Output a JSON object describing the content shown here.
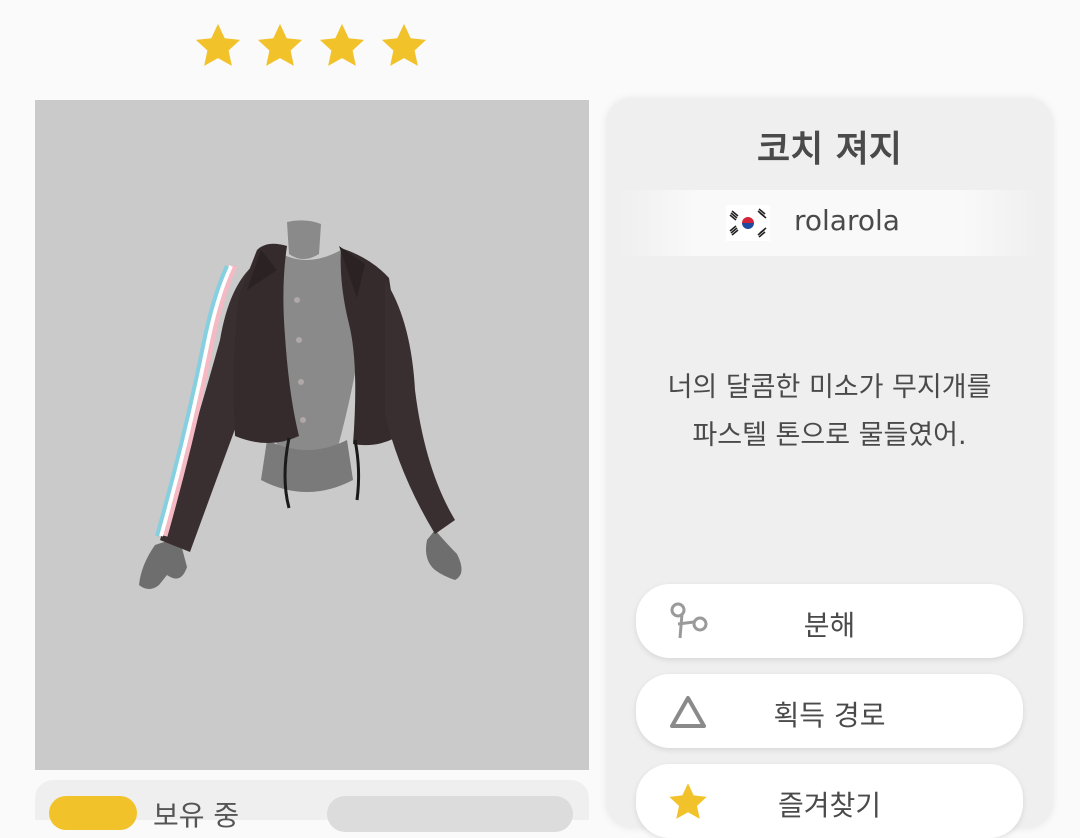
{
  "rating": {
    "stars": 4,
    "star_color": "#f2c22a"
  },
  "item": {
    "name": "코치 져지",
    "designer": {
      "country_flag": "korea-flag-icon",
      "name": "rolarola"
    },
    "description": "너의 달콤한 미소가 무지개를\n파스텔 톤으로 물들였어."
  },
  "actions": [
    {
      "label": "분해",
      "icon": "scissors-icon"
    },
    {
      "label": "획득 경로",
      "icon": "triangle-icon"
    },
    {
      "label": "즐겨찾기",
      "icon": "star-icon"
    }
  ],
  "bottom": {
    "owned_label": "보유 중"
  },
  "colors": {
    "accent": "#f2c22a",
    "preview_bg": "#cacaca",
    "panel_bg": "#efefef"
  }
}
